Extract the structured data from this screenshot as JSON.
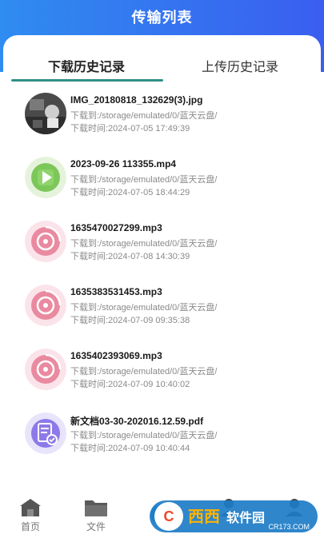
{
  "header": {
    "title": "传输列表"
  },
  "tabs": {
    "download": "下载历史记录",
    "upload": "上传历史记录"
  },
  "downloads": [
    {
      "name": "IMG_20180818_132629(3).jpg",
      "dest": "下载到:/storage/emulated/0/蓝天云盘/",
      "time": "下载时间:2024-07-05 17:49:39",
      "type": "photo"
    },
    {
      "name": "2023-09-26 113355.mp4",
      "dest": "下载到:/storage/emulated/0/蓝天云盘/",
      "time": "下载时间:2024-07-05 18:44:29",
      "type": "video"
    },
    {
      "name": "1635470027299.mp3",
      "dest": "下载到:/storage/emulated/0/蓝天云盘/",
      "time": "下载时间:2024-07-08 14:30:39",
      "type": "audio"
    },
    {
      "name": "1635383531453.mp3",
      "dest": "下载到:/storage/emulated/0/蓝天云盘/",
      "time": "下载时间:2024-07-09 09:35:38",
      "type": "audio"
    },
    {
      "name": "1635402393069.mp3",
      "dest": "下载到:/storage/emulated/0/蓝天云盘/",
      "time": "下载时间:2024-07-09 10:40:02",
      "type": "audio"
    },
    {
      "name": "新文档03-30-202016.12.59.pdf",
      "dest": "下载到:/storage/emulated/0/蓝天云盘/",
      "time": "下载时间:2024-07-09 10:40:44",
      "type": "document"
    }
  ],
  "nav": {
    "home": "首页",
    "files": "文件"
  },
  "watermark": {
    "brand": "西西",
    "text": "软件园",
    "site": "CR173.COM"
  },
  "colors": {
    "accent": "#2f8f86",
    "header": "#3a6cf0"
  }
}
